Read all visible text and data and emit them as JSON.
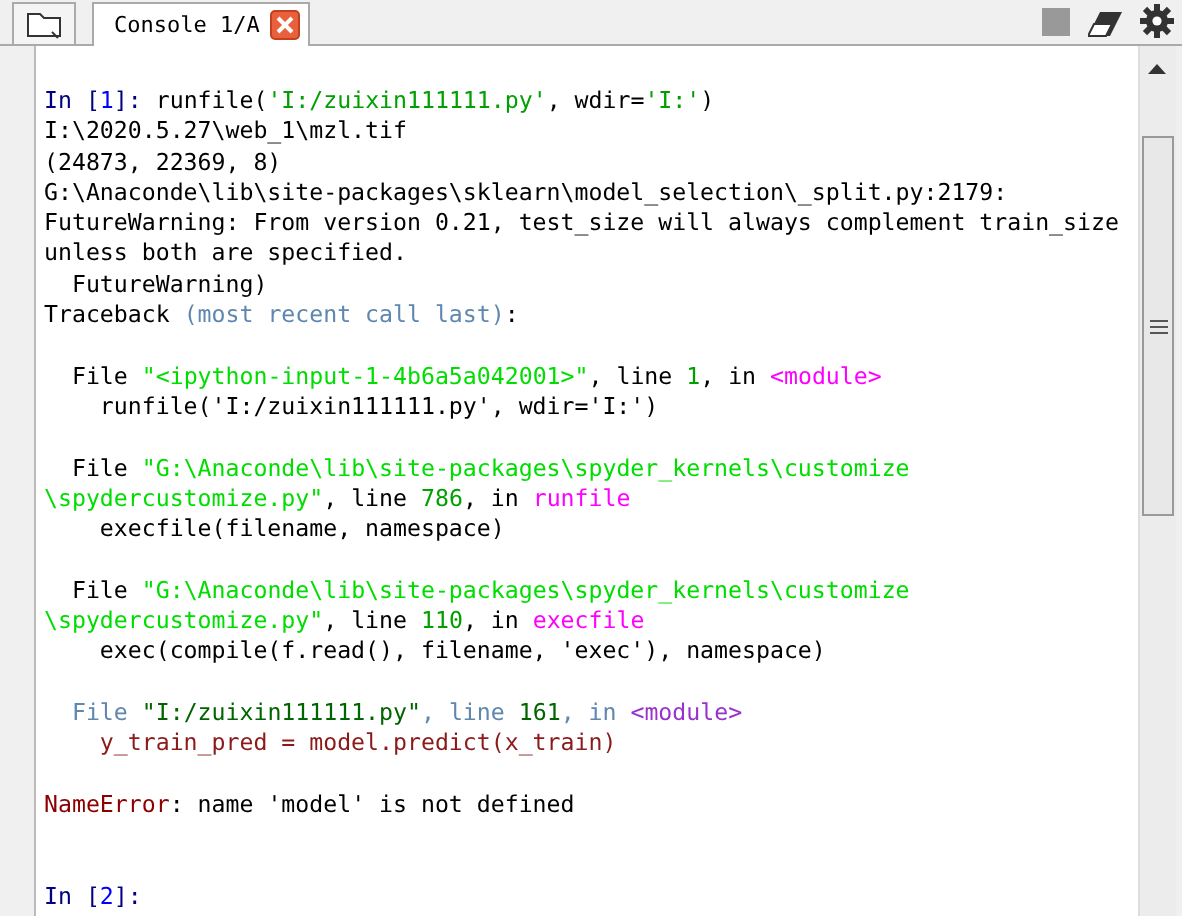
{
  "tabs": [
    {
      "label": "Console 1/A",
      "selected": true
    }
  ],
  "console": {
    "blocks": [
      {
        "wide_gap": false,
        "lines": [
          [
            {
              "kind": "prompt",
              "text": "In ["
            },
            {
              "kind": "prompt_num",
              "text": "1"
            },
            {
              "kind": "prompt",
              "text": "]: "
            },
            {
              "kind": "plain",
              "text": "runfile("
            },
            {
              "kind": "string",
              "text": "'I:/zuixin111111.py'"
            },
            {
              "kind": "plain",
              "text": ", wdir="
            },
            {
              "kind": "string",
              "text": "'I:'"
            },
            {
              "kind": "plain",
              "text": ")"
            }
          ],
          [
            {
              "kind": "plain",
              "text": "I:\\2020.5.27\\web_1\\mzl.tif"
            }
          ],
          [
            {
              "kind": "plain",
              "text": "(24873, 22369, 8)"
            }
          ],
          [
            {
              "kind": "plain",
              "text": "G:\\Anaconde\\lib\\site-packages\\sklearn\\model_selection\\_split.py:2179:"
            }
          ],
          [
            {
              "kind": "plain",
              "text": "FutureWarning: From version 0.21, test_size will always complement train_size"
            }
          ],
          [
            {
              "kind": "plain",
              "text": "unless both are specified."
            }
          ],
          [
            {
              "kind": "plain",
              "text": "  FutureWarning)"
            }
          ],
          [
            {
              "kind": "plain",
              "text": "Traceback "
            },
            {
              "kind": "muted",
              "text": "(most recent call last)"
            },
            {
              "kind": "plain",
              "text": ":"
            }
          ]
        ]
      },
      {
        "wide_gap": false,
        "lines": [
          [
            {
              "kind": "plain",
              "text": "  File "
            },
            {
              "kind": "path",
              "text": "\"<ipython-input-1-4b6a5a042001>\""
            },
            {
              "kind": "plain",
              "text": ", line "
            },
            {
              "kind": "lineno",
              "text": "1"
            },
            {
              "kind": "plain",
              "text": ", in "
            },
            {
              "kind": "func",
              "text": "<module>"
            }
          ],
          [
            {
              "kind": "plain",
              "text": "    runfile('I:/zuixin111111.py', wdir='I:')"
            }
          ]
        ]
      },
      {
        "wide_gap": false,
        "lines": [
          [
            {
              "kind": "plain",
              "text": "  File "
            },
            {
              "kind": "path",
              "text": "\"G:\\Anaconde\\lib\\site-packages\\spyder_kernels\\customize"
            }
          ],
          [
            {
              "kind": "path",
              "text": "\\spydercustomize.py\""
            },
            {
              "kind": "plain",
              "text": ", line "
            },
            {
              "kind": "lineno",
              "text": "786"
            },
            {
              "kind": "plain",
              "text": ", in "
            },
            {
              "kind": "func",
              "text": "runfile"
            }
          ],
          [
            {
              "kind": "plain",
              "text": "    execfile(filename, namespace)"
            }
          ]
        ]
      },
      {
        "wide_gap": false,
        "lines": [
          [
            {
              "kind": "plain",
              "text": "  File "
            },
            {
              "kind": "path",
              "text": "\"G:\\Anaconde\\lib\\site-packages\\spyder_kernels\\customize"
            }
          ],
          [
            {
              "kind": "path",
              "text": "\\spydercustomize.py\""
            },
            {
              "kind": "plain",
              "text": ", line "
            },
            {
              "kind": "lineno",
              "text": "110"
            },
            {
              "kind": "plain",
              "text": ", in "
            },
            {
              "kind": "func",
              "text": "execfile"
            }
          ],
          [
            {
              "kind": "plain",
              "text": "    exec(compile(f.read(), filename, 'exec'), namespace)"
            }
          ]
        ]
      },
      {
        "wide_gap": false,
        "lines": [
          [
            {
              "kind": "muted",
              "text": "  File "
            },
            {
              "kind": "userpath",
              "text": "\"I:/zuixin111111.py\""
            },
            {
              "kind": "muted",
              "text": ", line "
            },
            {
              "kind": "userlineno",
              "text": "161"
            },
            {
              "kind": "muted",
              "text": ", in "
            },
            {
              "kind": "userfunc",
              "text": "<module>"
            }
          ],
          [
            {
              "kind": "code",
              "text": "    y_train_pred = model.predict(x_train)"
            }
          ]
        ]
      },
      {
        "wide_gap": false,
        "lines": [
          [
            {
              "kind": "error",
              "text": "NameError"
            },
            {
              "kind": "plain",
              "text": ": name 'model' is not defined"
            }
          ]
        ]
      },
      {
        "wide_gap": true,
        "lines": [
          [
            {
              "kind": "prompt",
              "text": "In ["
            },
            {
              "kind": "prompt_num",
              "text": "2"
            },
            {
              "kind": "prompt",
              "text": "]:"
            }
          ]
        ]
      }
    ]
  }
}
